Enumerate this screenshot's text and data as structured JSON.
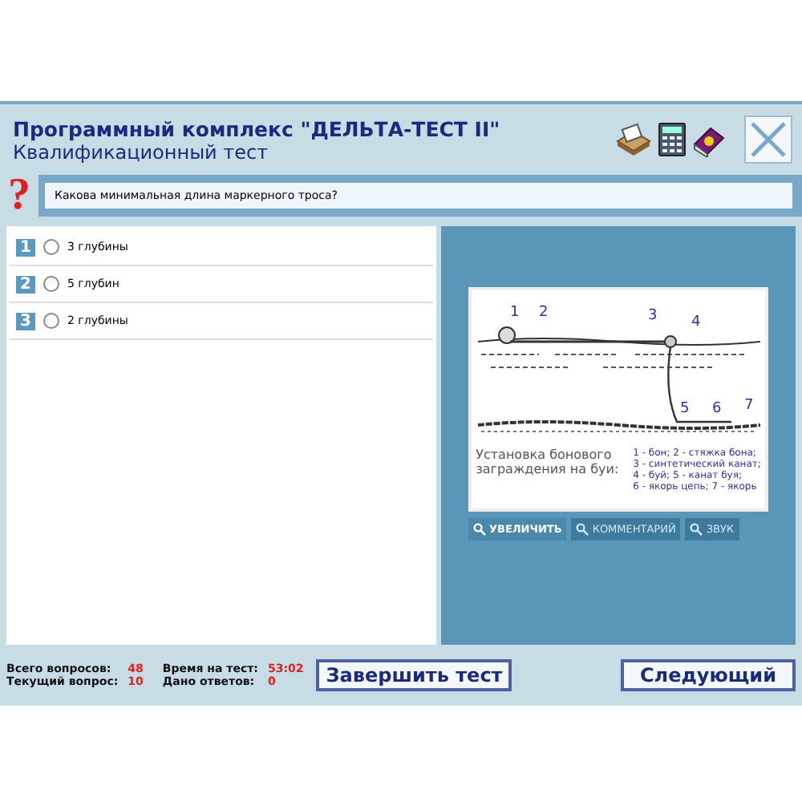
{
  "window": {
    "title": "Программный комплекс \"ДЕЛЬТА-ТЕСТ II\"",
    "subtitle": "Квалификационный тест"
  },
  "question": {
    "mark": "?",
    "text": "Какова минимальная длина маркерного троса?"
  },
  "answers": [
    {
      "number": "1",
      "label": "3 глубины",
      "selected": false
    },
    {
      "number": "2",
      "label": "5 глубин",
      "selected": false
    },
    {
      "number": "3",
      "label": "2 глубины",
      "selected": false
    }
  ],
  "figure": {
    "callouts": [
      "1",
      "2",
      "3",
      "4",
      "5",
      "6",
      "7"
    ],
    "caption": "Установка бонового заграждения на буи:",
    "legend": [
      "1 - бон; 2 - стяжка бона;",
      "3 - синтетический канат;",
      "4 - буй; 5 - канат буя;",
      "6 - якорь цепь; 7 - якорь"
    ]
  },
  "media_buttons": [
    {
      "label": "УВЕЛИЧИТЬ",
      "disabled": false
    },
    {
      "label": "КОММЕНТАРИЙ",
      "disabled": true
    },
    {
      "label": "ЗВУК",
      "disabled": true
    }
  ],
  "status": [
    {
      "label": "Всего вопросов:",
      "value": "48"
    },
    {
      "label": "Текущий вопрос:",
      "value": "10"
    },
    {
      "label": "Время на тест:",
      "value": "53:02"
    },
    {
      "label": "Дано ответов:",
      "value": "0"
    }
  ],
  "buttons": {
    "finish": "Завершить тест",
    "next": "Следующий"
  }
}
